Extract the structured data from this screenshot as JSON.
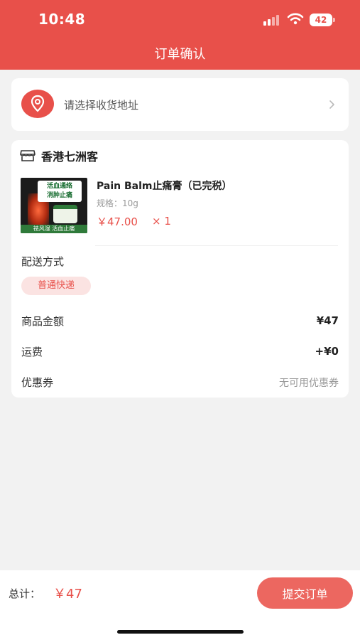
{
  "status_bar": {
    "time": "10:48",
    "battery": "42"
  },
  "header": {
    "title": "订单确认"
  },
  "address": {
    "placeholder_text": "请选择收货地址"
  },
  "store": {
    "name": "香港七洲客",
    "product": {
      "image_banner": "活血通络\n消肿止痛",
      "image_footer": "祛风湿 活血止痛",
      "name": "Pain Balm止痛膏（已完税）",
      "spec": "规格：10g",
      "price": "￥47.00",
      "quantity": "× 1"
    }
  },
  "shipping": {
    "label": "配送方式",
    "selected": "普通快递"
  },
  "summary": {
    "goods_amount_label": "商品金额",
    "goods_amount_value": "¥47",
    "freight_label": "运费",
    "freight_value": "+¥0",
    "coupon_label": "优惠券",
    "coupon_value": "无可用优惠券"
  },
  "footer": {
    "total_label": "总计：",
    "total_value": "￥47",
    "submit_label": "提交订单"
  },
  "colors": {
    "accent": "#e8504a",
    "button": "#ec6760",
    "tag_bg": "#fbe3e2"
  }
}
